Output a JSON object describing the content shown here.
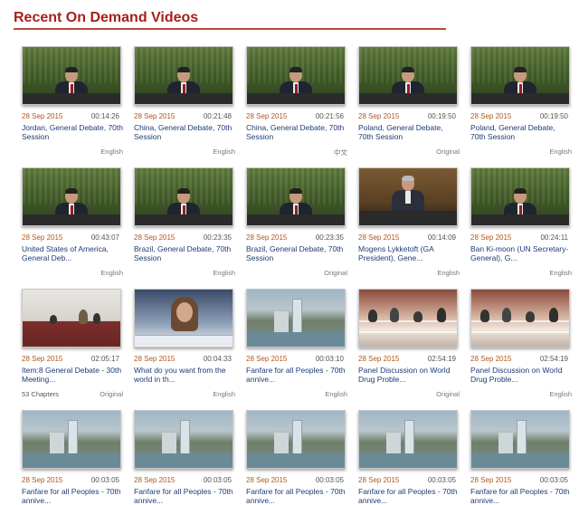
{
  "section_title": "Recent On Demand Videos",
  "videos": [
    {
      "date": "28 Sep 2015",
      "duration": "00:14:26",
      "title": "Jordan, General Debate, 70th Session",
      "language": "English",
      "chapters": "",
      "thumb": "green"
    },
    {
      "date": "28 Sep 2015",
      "duration": "00:21:48",
      "title": "China, General Debate, 70th Session",
      "language": "English",
      "chapters": "",
      "thumb": "green"
    },
    {
      "date": "28 Sep 2015",
      "duration": "00:21:56",
      "title": "China, General Debate, 70th Session",
      "language": "中文",
      "chapters": "",
      "thumb": "green"
    },
    {
      "date": "28 Sep 2015",
      "duration": "00:19:50",
      "title": "Poland, General Debate, 70th Session",
      "language": "Original",
      "chapters": "",
      "thumb": "green"
    },
    {
      "date": "28 Sep 2015",
      "duration": "00:19:50",
      "title": "Poland, General Debate, 70th Session",
      "language": "English",
      "chapters": "",
      "thumb": "green"
    },
    {
      "date": "28 Sep 2015",
      "duration": "00:43:07",
      "title": "United States of America, General Deb...",
      "language": "English",
      "chapters": "",
      "thumb": "green"
    },
    {
      "date": "28 Sep 2015",
      "duration": "00:23:35",
      "title": "Brazil, General Debate, 70th Session",
      "language": "English",
      "chapters": "",
      "thumb": "green"
    },
    {
      "date": "28 Sep 2015",
      "duration": "00:23:35",
      "title": "Brazil, General Debate, 70th Session",
      "language": "Original",
      "chapters": "",
      "thumb": "green"
    },
    {
      "date": "28 Sep 2015",
      "duration": "00:14:09",
      "title": "Mogens Lykketoft (GA President), Gene...",
      "language": "English",
      "chapters": "",
      "thumb": "brown"
    },
    {
      "date": "28 Sep 2015",
      "duration": "00:24:11",
      "title": "Ban Ki-moon (UN Secretary-General), G...",
      "language": "English",
      "chapters": "",
      "thumb": "green"
    },
    {
      "date": "28 Sep 2015",
      "duration": "02:05:17",
      "title": "Item:8 General Debate - 30th Meeting...",
      "language": "Original",
      "chapters": "53 Chapters",
      "thumb": "room"
    },
    {
      "date": "28 Sep 2015",
      "duration": "00:04:33",
      "title": "What do you want from the world in th...",
      "language": "English",
      "chapters": "",
      "thumb": "video"
    },
    {
      "date": "28 Sep 2015",
      "duration": "00:03:10",
      "title": "Fanfare for all Peoples - 70th annive...",
      "language": "English",
      "chapters": "",
      "thumb": "city"
    },
    {
      "date": "28 Sep 2015",
      "duration": "02:54:19",
      "title": "Panel Discussion on World Drug Proble...",
      "language": "Original",
      "chapters": "",
      "thumb": "panel"
    },
    {
      "date": "28 Sep 2015",
      "duration": "02:54:19",
      "title": "Panel Discussion on World Drug Proble...",
      "language": "English",
      "chapters": "",
      "thumb": "panel"
    },
    {
      "date": "28 Sep 2015",
      "duration": "00:03:05",
      "title": "Fanfare for all Peoples - 70th annive...",
      "language": "",
      "chapters": "",
      "thumb": "city"
    },
    {
      "date": "28 Sep 2015",
      "duration": "00:03:05",
      "title": "Fanfare for all Peoples - 70th annive...",
      "language": "",
      "chapters": "",
      "thumb": "city"
    },
    {
      "date": "28 Sep 2015",
      "duration": "00:03:05",
      "title": "Fanfare for all Peoples - 70th annive...",
      "language": "",
      "chapters": "",
      "thumb": "city"
    },
    {
      "date": "28 Sep 2015",
      "duration": "00:03:05",
      "title": "Fanfare for all Peoples - 70th annive...",
      "language": "",
      "chapters": "",
      "thumb": "city"
    },
    {
      "date": "28 Sep 2015",
      "duration": "00:03:05",
      "title": "Fanfare for all Peoples - 70th annive...",
      "language": "",
      "chapters": "",
      "thumb": "city"
    }
  ],
  "colors": {
    "title": "#a8201a",
    "date": "#b3561c",
    "link": "#1d3b77"
  }
}
